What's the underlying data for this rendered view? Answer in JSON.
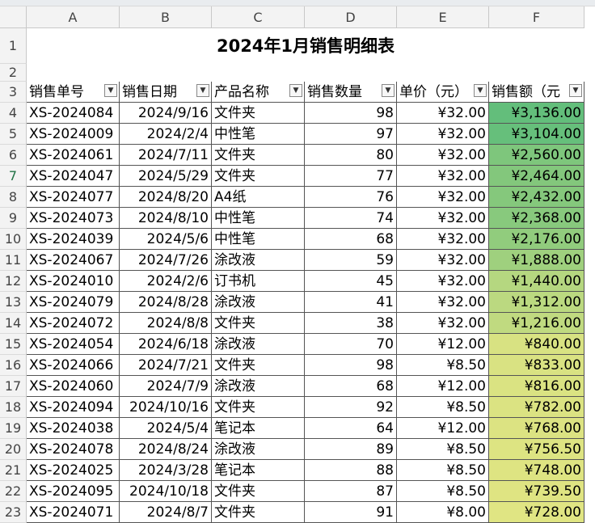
{
  "columns": [
    "A",
    "B",
    "C",
    "D",
    "E",
    "F"
  ],
  "title": "2024年1月销售明细表",
  "headers": [
    "销售单号",
    "销售日期",
    "产品名称",
    "销售数量",
    "单价（元）",
    "销售额（元"
  ],
  "filter_icon": "dropdown-arrow-icon",
  "row_numbers": [
    "1",
    "2",
    "3",
    "4",
    "5",
    "6",
    "7",
    "8",
    "9",
    "10",
    "11",
    "12",
    "13",
    "14",
    "15",
    "16",
    "17",
    "18",
    "19",
    "20",
    "21",
    "22",
    "23"
  ],
  "rows": [
    {
      "id": "XS-2024084",
      "date": "2024/9/16",
      "product": "文件夹",
      "qty": "98",
      "price": "¥32.00",
      "amount": "¥3,136.00",
      "shade": "#63be7b"
    },
    {
      "id": "XS-2024009",
      "date": "2024/2/4",
      "product": "中性笔",
      "qty": "97",
      "price": "¥32.00",
      "amount": "¥3,104.00",
      "shade": "#66bf7b"
    },
    {
      "id": "XS-2024061",
      "date": "2024/7/11",
      "product": "文件夹",
      "qty": "80",
      "price": "¥32.00",
      "amount": "¥2,560.00",
      "shade": "#7ec67c"
    },
    {
      "id": "XS-2024047",
      "date": "2024/5/29",
      "product": "文件夹",
      "qty": "77",
      "price": "¥32.00",
      "amount": "¥2,464.00",
      "shade": "#83c77c"
    },
    {
      "id": "XS-2024077",
      "date": "2024/8/20",
      "product": "A4纸",
      "qty": "76",
      "price": "¥32.00",
      "amount": "¥2,432.00",
      "shade": "#85c87c"
    },
    {
      "id": "XS-2024073",
      "date": "2024/8/10",
      "product": "中性笔",
      "qty": "74",
      "price": "¥32.00",
      "amount": "¥2,368.00",
      "shade": "#88c97d"
    },
    {
      "id": "XS-2024039",
      "date": "2024/5/6",
      "product": "中性笔",
      "qty": "68",
      "price": "¥32.00",
      "amount": "¥2,176.00",
      "shade": "#91cc7d"
    },
    {
      "id": "XS-2024067",
      "date": "2024/7/26",
      "product": "涂改液",
      "qty": "59",
      "price": "¥32.00",
      "amount": "¥1,888.00",
      "shade": "#9fd07e"
    },
    {
      "id": "XS-2024010",
      "date": "2024/2/6",
      "product": "订书机",
      "qty": "45",
      "price": "¥32.00",
      "amount": "¥1,440.00",
      "shade": "#b5d780"
    },
    {
      "id": "XS-2024079",
      "date": "2024/8/28",
      "product": "涂改液",
      "qty": "41",
      "price": "¥32.00",
      "amount": "¥1,312.00",
      "shade": "#bbd980"
    },
    {
      "id": "XS-2024072",
      "date": "2024/8/8",
      "product": "文件夹",
      "qty": "38",
      "price": "¥32.00",
      "amount": "¥1,216.00",
      "shade": "#c0da80"
    },
    {
      "id": "XS-2024054",
      "date": "2024/6/18",
      "product": "涂改液",
      "qty": "70",
      "price": "¥12.00",
      "amount": "¥840.00",
      "shade": "#d8e282"
    },
    {
      "id": "XS-2024066",
      "date": "2024/7/21",
      "product": "文件夹",
      "qty": "98",
      "price": "¥8.50",
      "amount": "¥833.00",
      "shade": "#d9e282"
    },
    {
      "id": "XS-2024060",
      "date": "2024/7/9",
      "product": "涂改液",
      "qty": "68",
      "price": "¥12.00",
      "amount": "¥816.00",
      "shade": "#dae382"
    },
    {
      "id": "XS-2024094",
      "date": "2024/10/16",
      "product": "文件夹",
      "qty": "92",
      "price": "¥8.50",
      "amount": "¥782.00",
      "shade": "#dbe382"
    },
    {
      "id": "XS-2024038",
      "date": "2024/5/4",
      "product": "笔记本",
      "qty": "64",
      "price": "¥12.00",
      "amount": "¥768.00",
      "shade": "#dce382"
    },
    {
      "id": "XS-2024078",
      "date": "2024/8/24",
      "product": "涂改液",
      "qty": "89",
      "price": "¥8.50",
      "amount": "¥756.50",
      "shade": "#dde482"
    },
    {
      "id": "XS-2024025",
      "date": "2024/3/28",
      "product": "笔记本",
      "qty": "88",
      "price": "¥8.50",
      "amount": "¥748.00",
      "shade": "#dee482"
    },
    {
      "id": "XS-2024095",
      "date": "2024/10/18",
      "product": "文件夹",
      "qty": "87",
      "price": "¥8.50",
      "amount": "¥739.50",
      "shade": "#dfe482"
    },
    {
      "id": "XS-2024071",
      "date": "2024/8/7",
      "product": "文件夹",
      "qty": "91",
      "price": "¥8.00",
      "amount": "¥728.00",
      "shade": "#e0e583"
    }
  ]
}
